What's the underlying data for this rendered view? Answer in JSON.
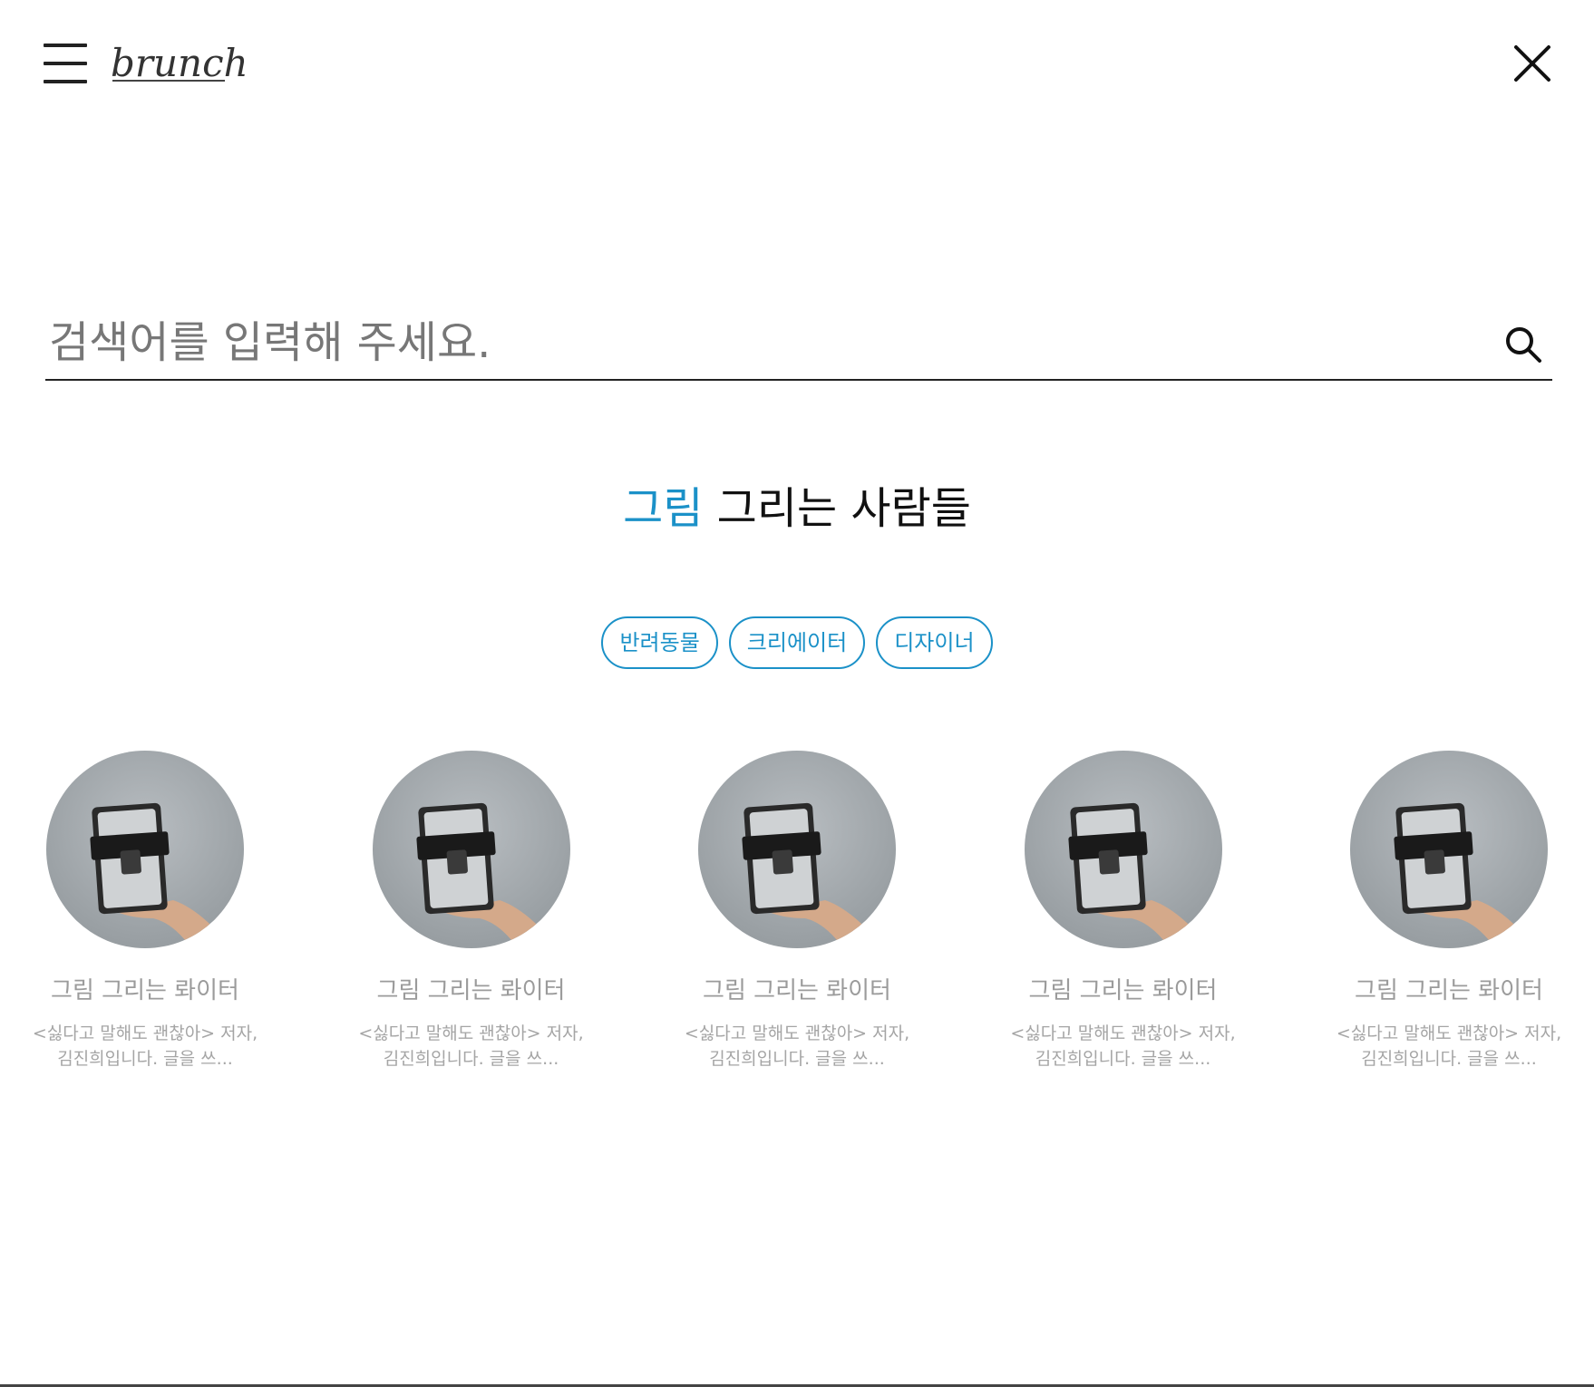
{
  "header": {
    "logo_text": "brunch",
    "menu_icon": "hamburger-menu-icon",
    "close_icon": "close-icon"
  },
  "search": {
    "placeholder": "검색어를 입력해 주세요.",
    "value": "",
    "icon": "search-icon"
  },
  "section": {
    "title_accent": "그림",
    "title_rest": " 그리는 사람들",
    "accent_color": "#1b91c8"
  },
  "tags": [
    {
      "label": "반려동물"
    },
    {
      "label": "크리에이터"
    },
    {
      "label": "디자이너"
    }
  ],
  "writers": [
    {
      "name": "그림 그리는 롸이터",
      "desc": "<싫다고 말해도 괜찮아> 저자, 김진희입니다. 글을 쓰..."
    },
    {
      "name": "그림 그리는 롸이터",
      "desc": "<싫다고 말해도 괜찮아> 저자, 김진희입니다. 글을 쓰..."
    },
    {
      "name": "그림 그리는 롸이터",
      "desc": "<싫다고 말해도 괜찮아> 저자, 김진희입니다. 글을 쓰..."
    },
    {
      "name": "그림 그리는 롸이터",
      "desc": "<싫다고 말해도 괜찮아> 저자, 김진희입니다. 글을 쓰..."
    },
    {
      "name": "그림 그리는 롸이터",
      "desc": "<싫다고 말해도 괜찮아> 저자, 김진희입니다. 글을 쓰..."
    }
  ]
}
